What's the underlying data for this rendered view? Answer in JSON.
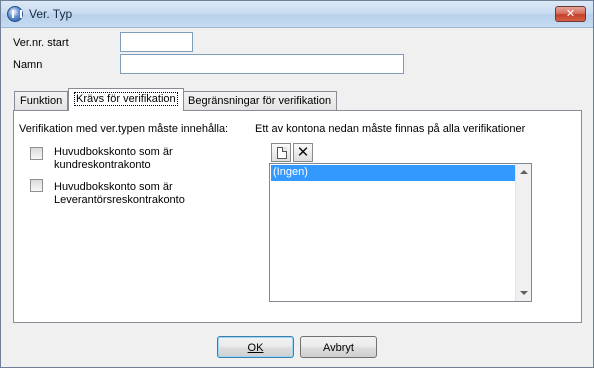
{
  "window": {
    "title": "Ver. Typ",
    "close_glyph": "✕",
    "icon": "app-logo-icon"
  },
  "fields": {
    "vernr_label": "Ver.nr. start",
    "vernr_value": "",
    "namn_label": "Namn",
    "namn_value": ""
  },
  "tabs": [
    {
      "label": "Funktion",
      "active": false
    },
    {
      "label": "Krävs för verifikation",
      "active": true
    },
    {
      "label": "Begränsningar för verifikation",
      "active": false
    }
  ],
  "panel": {
    "left_heading": "Verifikation med ver.typen måste innehålla:",
    "checkboxes": [
      {
        "line1": "Huvudbokskonto som är",
        "line2": "kundreskontrakonto",
        "checked": false
      },
      {
        "line1": "Huvudbokskonto som är",
        "line2": "Leverantörsreskontrakonto",
        "checked": false
      }
    ],
    "right_heading": "Ett av kontona nedan måste finnas på alla verifikationer",
    "toolbar": {
      "new_icon": "new-document-icon",
      "delete_icon": "delete-icon"
    },
    "list_items": [
      "(Ingen)"
    ]
  },
  "buttons": {
    "ok_label": "OK",
    "cancel_label": "Avbryt"
  }
}
